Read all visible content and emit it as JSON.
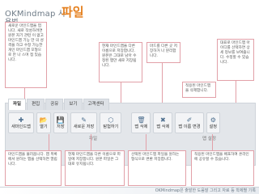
{
  "header": {
    "title_line1": "OKMindmap 사",
    "title_accent": "파일",
    "title_line2": "용법"
  },
  "callouts": [
    "새로운 마인드맵을 엽니다. 새로 작성하려면 원본 자기 관련 이 없고 마인드맵 기능 만 의 성격을 하고 수정 가능한 개인 마인드맵 모형으로 만 나 스며 접 있습니다.",
    "현재 마인드맵을 다른 이름으로 저장합니다. 원본은 그대로 남아 수정된 맵만 새로 저장됩니다.",
    "마드를 다른 곳 저장하거 나 분리합니다.",
    "적용된 마인드맵을 삭제합니다.",
    "마인드맵을 다른 사람과 공유합니다. 사용 권한 설정이 가능합니다.",
    "대표로 마인드맵 아이디를 선택하면 상세 정보를 보여줍니다. 수정할 수 있습니다."
  ],
  "bottom_callouts": [
    "마인드맵을 불러옵니다. 맵 목록에서 원하는 맵을 선택하면 열립니다.",
    "현재 마인드맵을 다른 이름으로 파일에 저장합니다. 원본 파일은 그대로 유지됩니다.",
    "선택된 마인드맵 파일을 원하는 형식으로 변환 저장합니다.",
    "적용된 마인드맵을 배포하여 온라인에 공유할 수 있습니다."
  ],
  "tabs": [
    "파일",
    "편집",
    "공유",
    "보기",
    "고객센터"
  ],
  "toolbar": {
    "buttons": [
      {
        "label": "새마인드맵",
        "icon": "✚"
      },
      {
        "label": "열기",
        "icon": "📂"
      },
      {
        "label": "저장",
        "icon": "💾"
      },
      {
        "label": "새로운 저장",
        "icon": "✎"
      },
      {
        "label": "탐험하기",
        "icon": "⬡"
      },
      {
        "label": "맵 삭제",
        "icon": "🗑"
      },
      {
        "label": "맵 삭제",
        "icon": "✖"
      },
      {
        "label": "맵 이름 변경",
        "icon": "✐"
      },
      {
        "label": "설정",
        "icon": "⚙"
      }
    ],
    "group_file": "파일",
    "group_map": "맵 설정"
  },
  "footer": {
    "text": "OKMindmap은 출발한 도움말 그리고 자료 등 학제별 기록"
  }
}
